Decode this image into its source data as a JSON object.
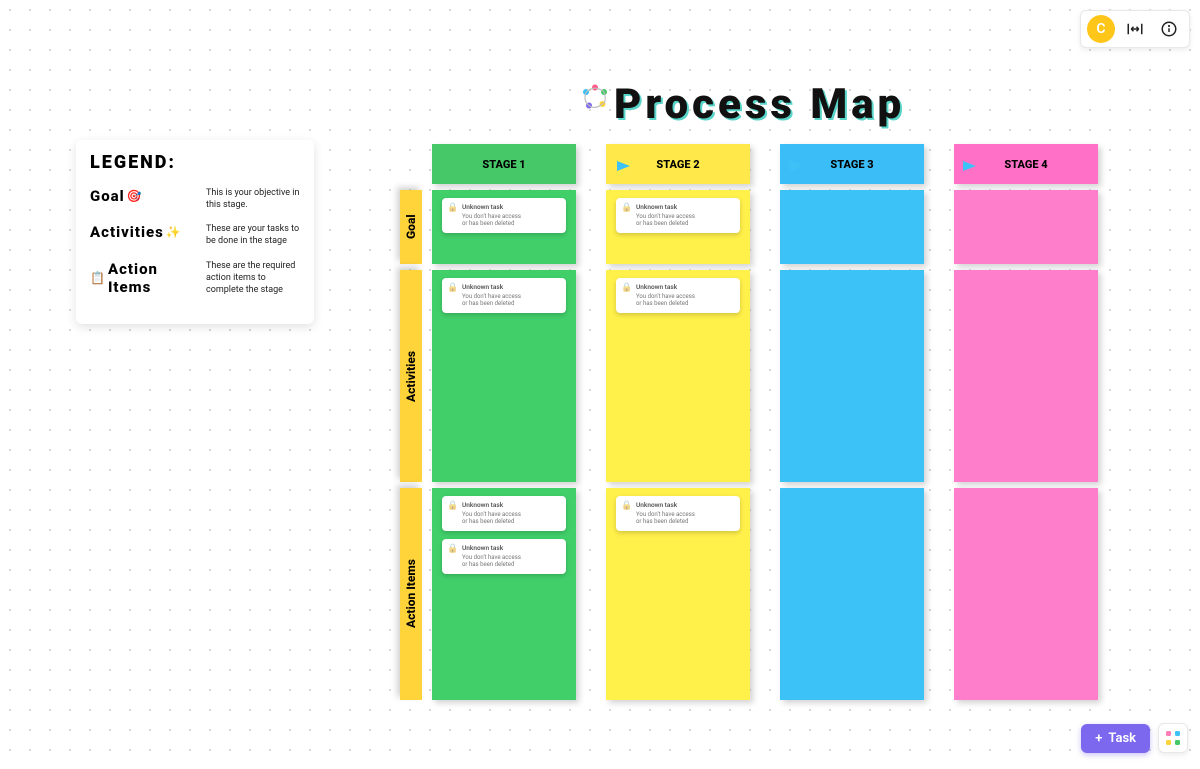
{
  "header": {
    "title": "Process Map",
    "avatar_initial": "C"
  },
  "toolbar": {
    "task_label": "Task"
  },
  "legend": {
    "title": "LEGEND:",
    "rows": [
      {
        "term": "Goal",
        "icon": "🎯",
        "desc": "This is your objective in this stage."
      },
      {
        "term": "Activities",
        "icon": "✨",
        "desc": "These are your tasks to be done in the stage"
      },
      {
        "term": "Action Items",
        "icon": "📋",
        "desc": "These are the required action items to complete the stage"
      }
    ]
  },
  "board": {
    "row_labels": [
      "Goal",
      "Activities",
      "Action Items"
    ],
    "stages": [
      {
        "label": "STAGE 1",
        "color": "green"
      },
      {
        "label": "STAGE 2",
        "color": "yellow"
      },
      {
        "label": "STAGE 3",
        "color": "blue"
      },
      {
        "label": "STAGE 4",
        "color": "pink"
      }
    ],
    "card": {
      "title": "Unknown task",
      "line1": "You don't have access",
      "line2": "or has been deleted"
    }
  }
}
